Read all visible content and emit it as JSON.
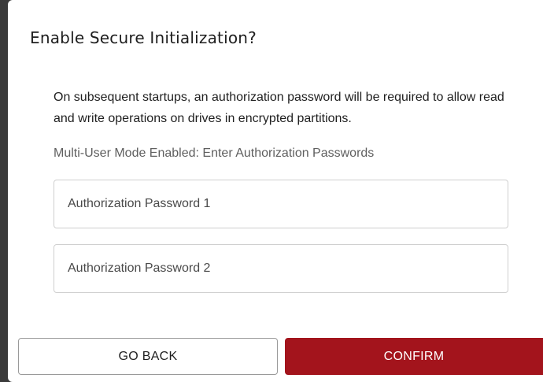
{
  "dialog": {
    "title": "Enable Secure Initialization?",
    "description": "On subsequent startups, an authorization password will be required to allow read and write operations on drives in encrypted partitions.",
    "mode_label": "Multi-User Mode Enabled: Enter Authorization Passwords",
    "fields": [
      {
        "placeholder": "Authorization Password 1",
        "value": ""
      },
      {
        "placeholder": "Authorization Password 2",
        "value": ""
      }
    ],
    "buttons": {
      "back_label": "GO BACK",
      "confirm_label": "CONFIRM"
    }
  },
  "colors": {
    "confirm_background": "#a3141c",
    "dialog_background": "#ffffff"
  }
}
